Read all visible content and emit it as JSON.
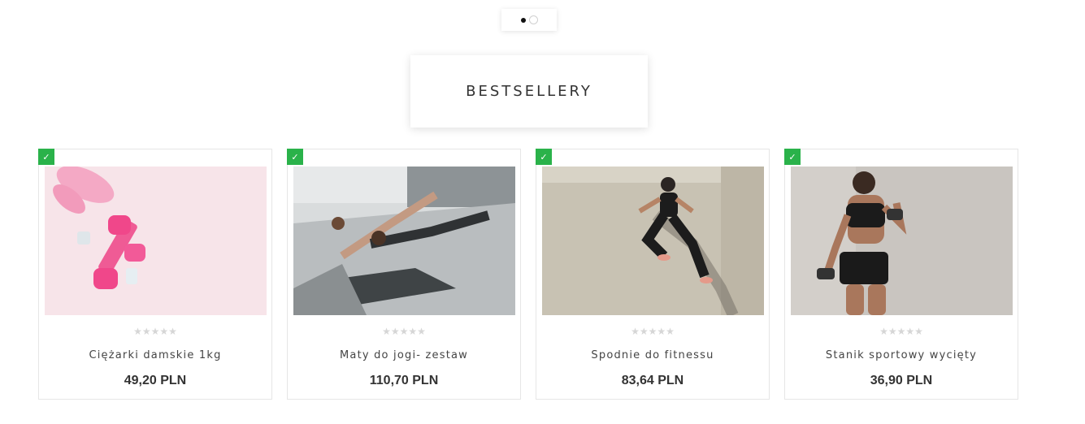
{
  "carousel": {
    "pages": 2,
    "active": 1
  },
  "section": {
    "title": "BESTSELLERY"
  },
  "products": [
    {
      "name": "Ciężarki damskie 1kg",
      "price": "49,20 PLN",
      "rating_stars": "★★★★★",
      "image": "pink-dumbbells-sneakers",
      "badge_icon": "check-icon"
    },
    {
      "name": "Maty do jogi- zestaw",
      "price": "110,70 PLN",
      "rating_stars": "★★★★★",
      "image": "couple-planking-outdoors",
      "badge_icon": "check-icon"
    },
    {
      "name": "Spodnie do fitnessu",
      "price": "83,64 PLN",
      "rating_stars": "★★★★★",
      "image": "woman-jumping-wall",
      "badge_icon": "check-icon"
    },
    {
      "name": "Stanik sportowy wycięty",
      "price": "36,90 PLN",
      "rating_stars": "★★★★★",
      "image": "woman-lifting-dumbbells",
      "badge_icon": "check-icon"
    }
  ],
  "colors": {
    "badge": "#2ab24a",
    "star_empty": "#d6d6d6",
    "text": "#333333"
  }
}
